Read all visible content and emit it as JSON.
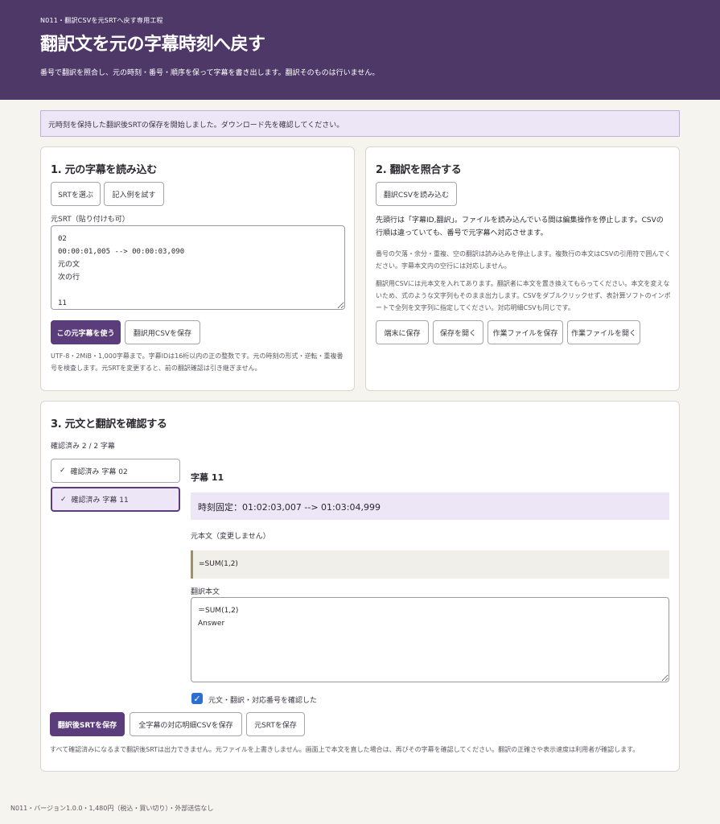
{
  "header": {
    "eyebrow": "N011・翻訳CSVを元SRTへ戻す専用工程",
    "title": "翻訳文を元の字幕時刻へ戻す",
    "description": "番号で翻訳を照合し、元の時刻・番号・順序を保って字幕を書き出します。翻訳そのものは行いません。"
  },
  "notice": "元時刻を保持した翻訳後SRTの保存を開始しました。ダウンロード先を確認してください。",
  "step1": {
    "title": "1. 元の字幕を読み込む",
    "select_srt": "SRTを選ぶ",
    "try_example": "記入例を試す",
    "textarea_label": "元SRT（貼り付けも可）",
    "textarea_value": "02\n00:00:01,005 --> 00:00:03,090\n元の文\n次の行\n\n11",
    "use_button": "この元字幕を使う",
    "save_csv_button": "翻訳用CSVを保存",
    "help": "UTF-8・2MiB・1,000字幕まで。字幕IDは16桁以内の正の整数です。元の時刻の形式・逆転・重複番号を検査します。元SRTを変更すると、前の翻訳確認は引き継ぎません。"
  },
  "step2": {
    "title": "2. 翻訳を照合する",
    "load_csv": "翻訳CSVを読み込む",
    "desc1": "先頭行は「字幕ID,翻訳」。ファイルを読み込んでいる間は編集操作を停止します。CSVの行順は違っていても、番号で元字幕へ対応させます。",
    "desc2": "番号の欠落・余分・重複、空の翻訳は読み込みを停止します。複数行の本文はCSVの引用符で囲んでください。字幕本文内の空行には対応しません。",
    "desc3": "翻訳用CSVには元本文を入れてあります。翻訳者に本文を置き換えてもらってください。本文を変えないため、式のような文字列もそのまま出力します。CSVをダブルクリックせず、表計算ソフトのインポートで全列を文字列に指定してください。対応明細CSVも同じです。",
    "save_device": "端末に保存",
    "open_save": "保存を開く",
    "save_work": "作業ファイルを保存",
    "open_work": "作業ファイルを開く"
  },
  "step3": {
    "title": "3. 元文と翻訳を確認する",
    "progress": "確認済み 2 / 2 字幕",
    "items": [
      {
        "check": "✓",
        "label": "確認済み 字幕 02"
      },
      {
        "check": "✓",
        "label": "確認済み 字幕 11"
      }
    ],
    "detail_title": "字幕 11",
    "time_fixed": "時刻固定：01:02:03,007 --> 01:03:04,999",
    "original_label": "元本文（変更しません）",
    "original_text": "=SUM(1,2)",
    "translation_label": "翻訳本文",
    "translation_value": "＝SUM(1,2)\nAnswer",
    "confirm_label": "元文・翻訳・対応番号を確認した",
    "save_srt": "翻訳後SRTを保存",
    "save_detail_csv": "全字幕の対応明細CSVを保存",
    "save_orig_srt": "元SRTを保存",
    "note": "すべて確認済みになるまで翻訳後SRTは出力できません。元ファイルを上書きしません。画面上で本文を直した場合は、再びその字幕を確認してください。翻訳の正確さや表示速度は利用者が確認します。"
  },
  "footer": "N011・バージョン1.0.0・1,480円（税込・買い切り）・外部送信なし"
}
